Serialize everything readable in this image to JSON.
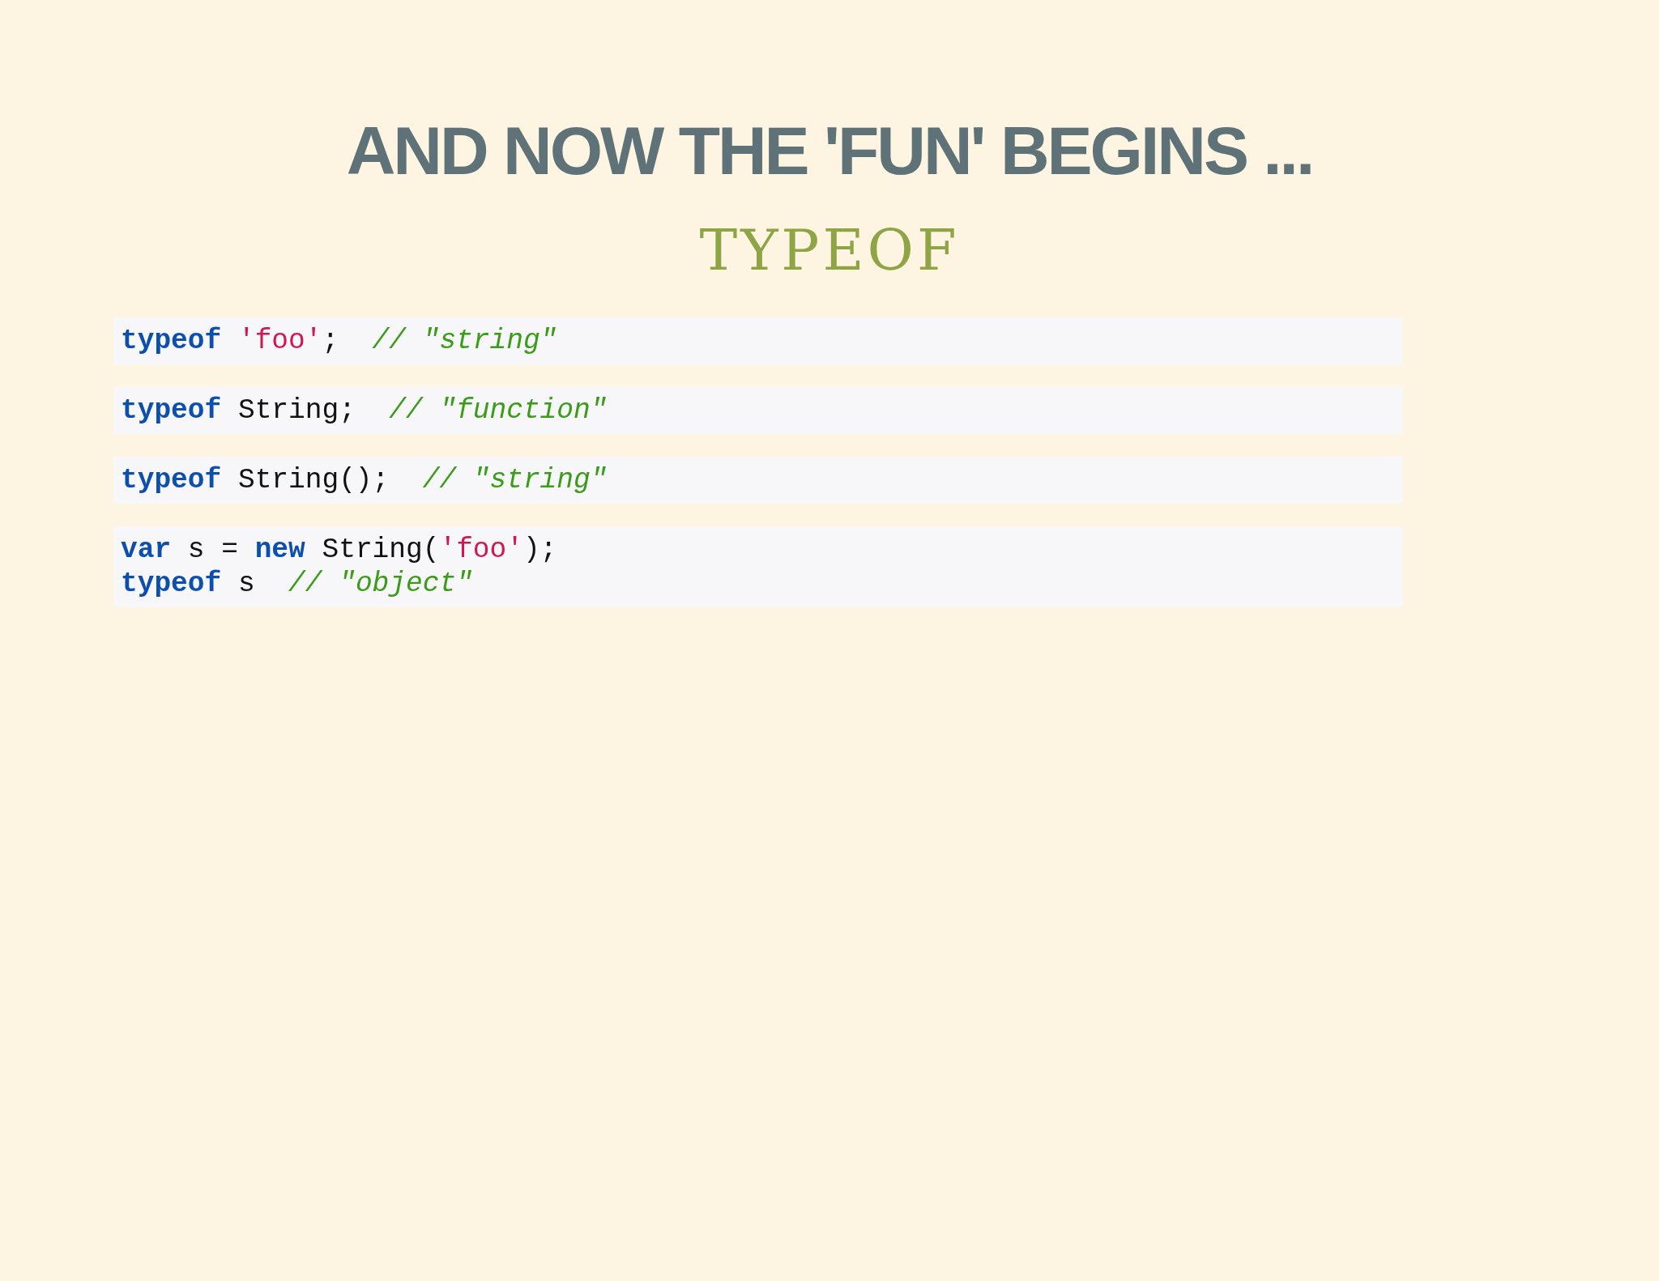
{
  "title": "AND NOW THE 'FUN' BEGINS ...",
  "subtitle": "TYPEOF",
  "code_blocks": [
    {
      "lines": [
        [
          {
            "kind": "keyword",
            "text": "typeof "
          },
          {
            "kind": "string",
            "text": "'foo'"
          },
          {
            "kind": "plain",
            "text": ";  "
          },
          {
            "kind": "comment",
            "text": "// \"string\""
          }
        ]
      ]
    },
    {
      "lines": [
        [
          {
            "kind": "keyword",
            "text": "typeof"
          },
          {
            "kind": "plain",
            "text": " String;  "
          },
          {
            "kind": "comment",
            "text": "// \"function\""
          }
        ]
      ]
    },
    {
      "lines": [
        [
          {
            "kind": "keyword",
            "text": "typeof"
          },
          {
            "kind": "plain",
            "text": " String();  "
          },
          {
            "kind": "comment",
            "text": "// \"string\""
          }
        ]
      ]
    },
    {
      "lines": [
        [
          {
            "kind": "keyword",
            "text": "var"
          },
          {
            "kind": "plain",
            "text": " s = "
          },
          {
            "kind": "keyword",
            "text": "new"
          },
          {
            "kind": "plain",
            "text": " String("
          },
          {
            "kind": "string",
            "text": "'foo'"
          },
          {
            "kind": "plain",
            "text": ");"
          }
        ],
        [
          {
            "kind": "keyword",
            "text": "typeof"
          },
          {
            "kind": "plain",
            "text": " s  "
          },
          {
            "kind": "comment",
            "text": "// \"object\""
          }
        ]
      ]
    }
  ]
}
